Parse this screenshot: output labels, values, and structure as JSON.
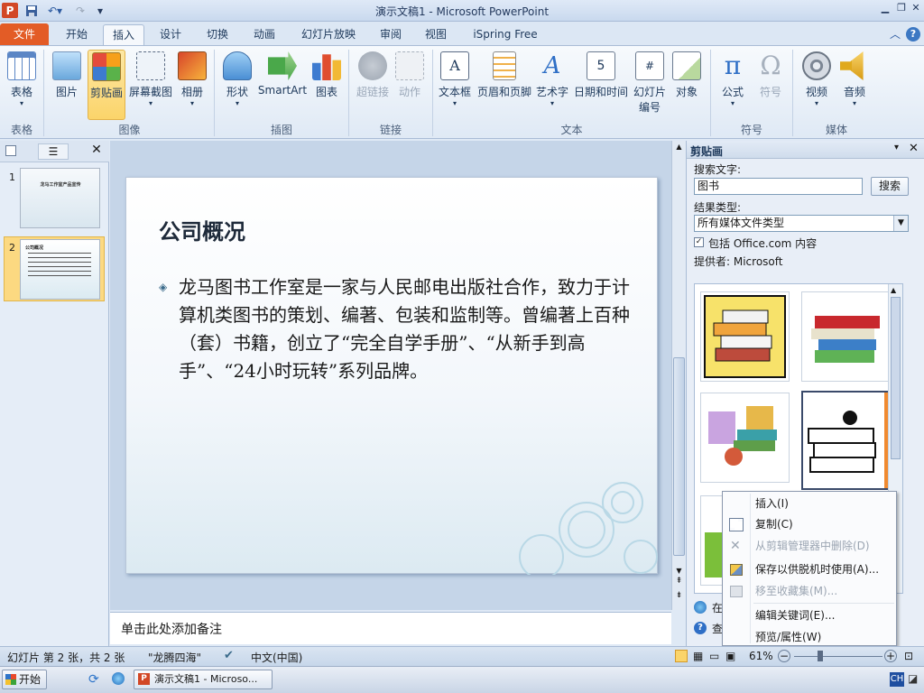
{
  "window": {
    "title": "演示文稿1 - Microsoft PowerPoint",
    "app_icon": "P"
  },
  "tabs": [
    {
      "label": "文件"
    },
    {
      "label": "开始"
    },
    {
      "label": "插入"
    },
    {
      "label": "设计"
    },
    {
      "label": "切换"
    },
    {
      "label": "动画"
    },
    {
      "label": "幻灯片放映"
    },
    {
      "label": "审阅"
    },
    {
      "label": "视图"
    },
    {
      "label": "iSpring Free"
    }
  ],
  "active_tab": "插入",
  "ribbon": {
    "buttons": [
      {
        "label": "表格",
        "icon": "table-icon"
      },
      {
        "label": "图片",
        "icon": "picture-icon"
      },
      {
        "label": "剪贴画",
        "icon": "clipart-icon"
      },
      {
        "label": "屏幕截图",
        "icon": "screenshot-icon"
      },
      {
        "label": "相册",
        "icon": "album-icon"
      },
      {
        "label": "形状",
        "icon": "shapes-icon"
      },
      {
        "label": "SmartArt",
        "icon": "smartart-icon"
      },
      {
        "label": "图表",
        "icon": "chart-icon"
      },
      {
        "label": "超链接",
        "icon": "hyperlink-icon"
      },
      {
        "label": "动作",
        "icon": "action-icon"
      },
      {
        "label": "文本框",
        "icon": "textbox-icon"
      },
      {
        "label": "页眉和页脚",
        "icon": "header-footer-icon"
      },
      {
        "label": "艺术字",
        "icon": "wordart-icon"
      },
      {
        "label": "日期和时间",
        "icon": "datetime-icon"
      },
      {
        "label": "幻灯片",
        "label2": "编号",
        "icon": "slide-number-icon"
      },
      {
        "label": "对象",
        "icon": "object-icon"
      },
      {
        "label": "公式",
        "icon": "equation-icon"
      },
      {
        "label": "符号",
        "icon": "symbol-icon"
      },
      {
        "label": "视频",
        "icon": "video-icon"
      },
      {
        "label": "音频",
        "icon": "audio-icon"
      }
    ],
    "groups": [
      "表格",
      "图像",
      "插图",
      "链接",
      "文本",
      "符号",
      "媒体"
    ]
  },
  "thumbnails": [
    {
      "number": "1",
      "title": "龙马工作室产品宣传"
    },
    {
      "number": "2",
      "title": "公司概况"
    }
  ],
  "slide": {
    "title": "公司概况",
    "bullet": "龙马图书工作室是一家与人民邮电出版社合作，致力于计算机类图书的策划、编著、包装和监制等。曾编著上百种（套）书籍，创立了“完全自学手册”、“从新手到高手”、“24小时玩转”系列品牌。"
  },
  "notes_placeholder": "单击此处添加备注",
  "clip_pane": {
    "title": "剪贴画",
    "search_label": "搜索文字:",
    "search_value": "图书",
    "search_button": "搜索",
    "result_type_label": "结果类型:",
    "result_type_value": "所有媒体文件类型",
    "include_office": "包括 Office.com 内容",
    "provider": "提供者: Microsoft",
    "bottom_links": [
      "在",
      "查"
    ]
  },
  "context_menu": [
    {
      "label": "插入(I)",
      "enabled": true
    },
    {
      "label": "复制(C)",
      "enabled": true,
      "icon": "copy-icon"
    },
    {
      "label": "从剪辑管理器中删除(D)",
      "enabled": false,
      "icon": "delete-x-icon"
    },
    {
      "label": "保存以供脱机时使用(A)...",
      "enabled": true,
      "icon": "save-offline-icon"
    },
    {
      "label": "移至收藏集(M)...",
      "enabled": false,
      "icon": "move-collection-icon"
    },
    {
      "label": "编辑关键词(E)...",
      "enabled": true
    },
    {
      "label": "预览/属性(W)",
      "enabled": true
    }
  ],
  "status": {
    "slide_info": "幻灯片 第 2 张，共 2 张",
    "theme": "\"龙腾四海\"",
    "language": "中文(中国)",
    "zoom": "61%"
  },
  "taskbar": {
    "start": "开始",
    "task": "演示文稿1 - Microso...",
    "ime": "CH"
  }
}
